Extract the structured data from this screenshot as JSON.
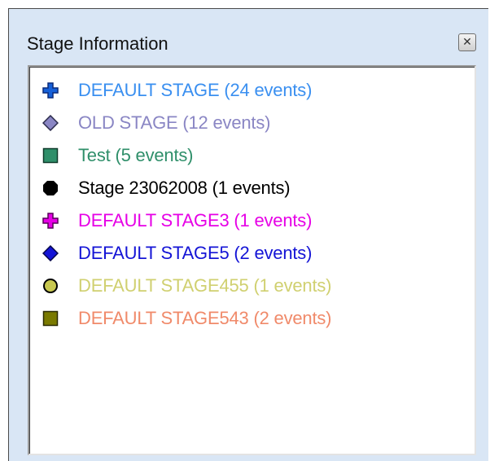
{
  "window": {
    "title": "Stage Information",
    "close_icon": "close-icon"
  },
  "stages": [
    {
      "label": "DEFAULT STAGE (24 events)",
      "color": "#3a8ff0",
      "icon": "blue-plus-icon"
    },
    {
      "label": "OLD STAGE (12 events)",
      "color": "#8a86c4",
      "icon": "lavender-diamond-icon"
    },
    {
      "label": "Test (5 events)",
      "color": "#2f8f6a",
      "icon": "green-square-icon"
    },
    {
      "label": "Stage 23062008 (1 events)",
      "color": "#000000",
      "icon": "black-octagon-icon"
    },
    {
      "label": "DEFAULT STAGE3 (1 events)",
      "color": "#e600e6",
      "icon": "magenta-plus-icon"
    },
    {
      "label": "DEFAULT STAGE5 (2 events)",
      "color": "#1414d6",
      "icon": "blue-diamond-icon"
    },
    {
      "label": "DEFAULT STAGE455 (1 events)",
      "color": "#d0d070",
      "icon": "yellow-circle-icon"
    },
    {
      "label": "DEFAULT STAGE543 (2 events)",
      "color": "#f08a6a",
      "icon": "olive-square-icon"
    }
  ]
}
